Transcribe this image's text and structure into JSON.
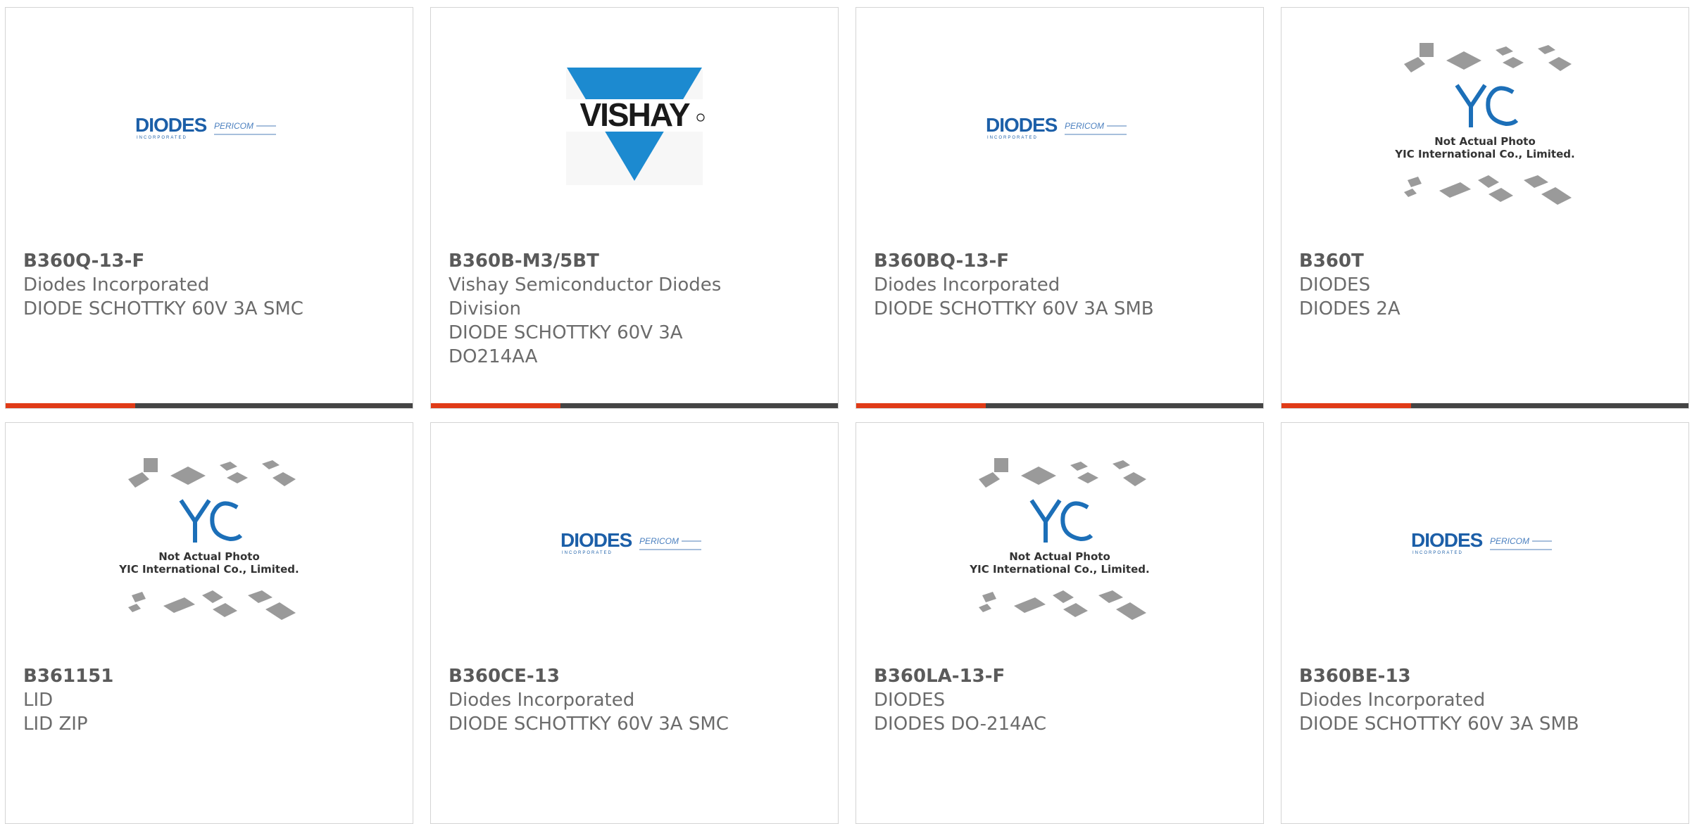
{
  "products": [
    {
      "part": "B360Q-13-F",
      "manufacturer": "Diodes Incorporated",
      "description": "DIODE SCHOTTKY 60V 3A SMC",
      "image": "diodes-logo"
    },
    {
      "part": "B360B-M3/5BT",
      "manufacturer": "Vishay Semiconductor Diodes Division",
      "description": "DIODE SCHOTTKY 60V 3A DO214AA",
      "image": "vishay-logo"
    },
    {
      "part": "B360BQ-13-F",
      "manufacturer": "Diodes Incorporated",
      "description": "DIODE SCHOTTKY 60V 3A SMB",
      "image": "diodes-logo"
    },
    {
      "part": "B360T",
      "manufacturer": "DIODES",
      "description": "DIODES 2A",
      "image": "yic-placeholder"
    },
    {
      "part": "B361151",
      "manufacturer": "LID",
      "description": "LID ZIP",
      "image": "yic-placeholder"
    },
    {
      "part": "B360CE-13",
      "manufacturer": "Diodes Incorporated",
      "description": "DIODE SCHOTTKY 60V 3A SMC",
      "image": "diodes-logo"
    },
    {
      "part": "B360LA-13-F",
      "manufacturer": "DIODES",
      "description": "DIODES DO-214AC",
      "image": "yic-placeholder"
    },
    {
      "part": "B360BE-13",
      "manufacturer": "Diodes Incorporated",
      "description": "DIODE SCHOTTKY 60V 3A SMB",
      "image": "diodes-logo"
    }
  ],
  "logos": {
    "diodes": "DIODES",
    "diodes_tagline": "INCORPORATED",
    "pericom": "PERICOM",
    "vishay": "VISHAY"
  },
  "placeholder": {
    "logo_text": "YIC",
    "line1": "Not Actual Photo",
    "line2": "YIC International Co., Limited."
  },
  "colors": {
    "accent": "#e03b17",
    "bar": "#444444",
    "diodes_blue": "#1c5fa8",
    "vishay_blue": "#1c8ad0"
  }
}
